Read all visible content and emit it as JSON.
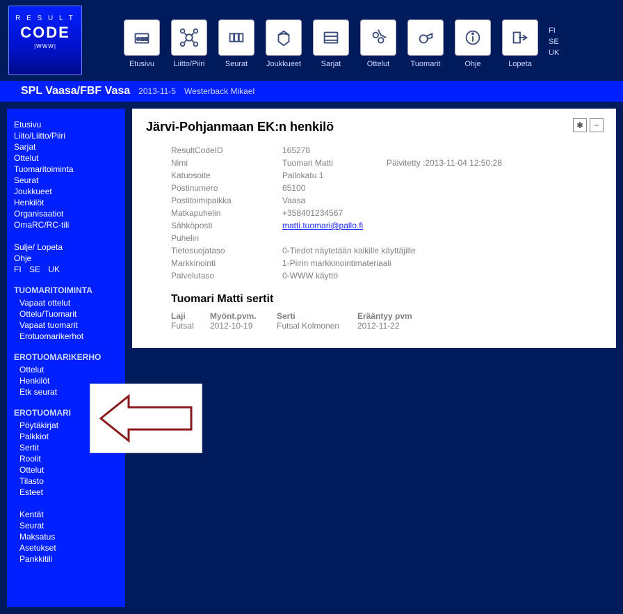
{
  "logo": {
    "line1": "R E S U L T",
    "line2": "CODE",
    "line3": "|WWW|"
  },
  "nav": [
    {
      "label": "Etusivu"
    },
    {
      "label": "Liitto/Piiri"
    },
    {
      "label": "Seurat"
    },
    {
      "label": "Joukkueet"
    },
    {
      "label": "Sarjat"
    },
    {
      "label": "Ottelut"
    },
    {
      "label": "Tuomarit"
    },
    {
      "label": "Ohje"
    },
    {
      "label": "Lopeta"
    }
  ],
  "lang_top": [
    "FI",
    "SE",
    "UK"
  ],
  "titlebar": {
    "main": "SPL Vaasa/FBF Vasa",
    "date": "2013-11-5",
    "user": "Westerback Mikael"
  },
  "sidebar": {
    "main": [
      "Etusivu",
      "Liito/Liitto/Piiri",
      "Sarjat",
      "Ottelut",
      "Tuomaritoiminta",
      "Seurat",
      "Joukkueet",
      "Henkilöt",
      "Organisaatiot",
      "OmaRC/RC-tili"
    ],
    "aux": [
      "Sulje/ Lopeta",
      "Ohje"
    ],
    "lang": [
      "FI",
      "SE",
      "UK"
    ],
    "sections": [
      {
        "title": "TUOMARITOIMINTA",
        "items": [
          "Vapaat ottelut",
          "Ottelu/Tuomarit",
          "Vapaat tuomarit",
          "Erotuomarikerhot"
        ]
      },
      {
        "title": "EROTUOMARIKERHO",
        "items": [
          "Ottelut",
          "Henkilöt",
          "Etk seurat"
        ]
      },
      {
        "title": "EROTUOMARI",
        "items": [
          "Pöytäkirjat",
          "Palkkiot",
          "Sertit",
          "Roolit",
          "Ottelut",
          "Tilasto",
          "Esteet"
        ],
        "items2": [
          "Kentät",
          "Seurat",
          "Maksatus",
          "Asetukset",
          "Pankkitili"
        ]
      }
    ]
  },
  "content": {
    "title": "Järvi-Pohjanmaan EK:n henkilö",
    "fields": {
      "resultcodeid_l": "ResultCodeID",
      "resultcodeid_v": "165278",
      "nimi_l": "Nimi",
      "nimi_v": "Tuomari Matti",
      "updated": "Päivitetty :2013-11-04 12:50:28",
      "katu_l": "Katuosoite",
      "katu_v": "Pallokatu 1",
      "post_l": "Postinumero",
      "post_v": "65100",
      "kaup_l": "Postitoimipaikka",
      "kaup_v": "Vaasa",
      "mob_l": "Matkapuhelin",
      "mob_v": "+358401234567",
      "email_l": "Sähköposti",
      "email_v": "matti.tuomari@pallo.fi",
      "tel_l": "Puhelin",
      "tel_v": "",
      "tiet_l": "Tietosuojataso",
      "tiet_v": "0-Tiedot näytetään kaikille käyttäjille",
      "mark_l": "Markkinointi",
      "mark_v": "1-Piirin markkinointimateriaali",
      "palv_l": "Palvelutaso",
      "palv_v": "0-WWW käyttö"
    },
    "sub_title": "Tuomari Matti sertit",
    "cert_head": {
      "laji": "Laji",
      "myont": "Myönt.pvm.",
      "serti": "Serti",
      "era": "Erääntyy pvm"
    },
    "cert_row": {
      "laji": "Futsal",
      "myont": "2012-10-19",
      "serti": "Futsal Kolmonen",
      "era": "2012-11-22"
    }
  }
}
